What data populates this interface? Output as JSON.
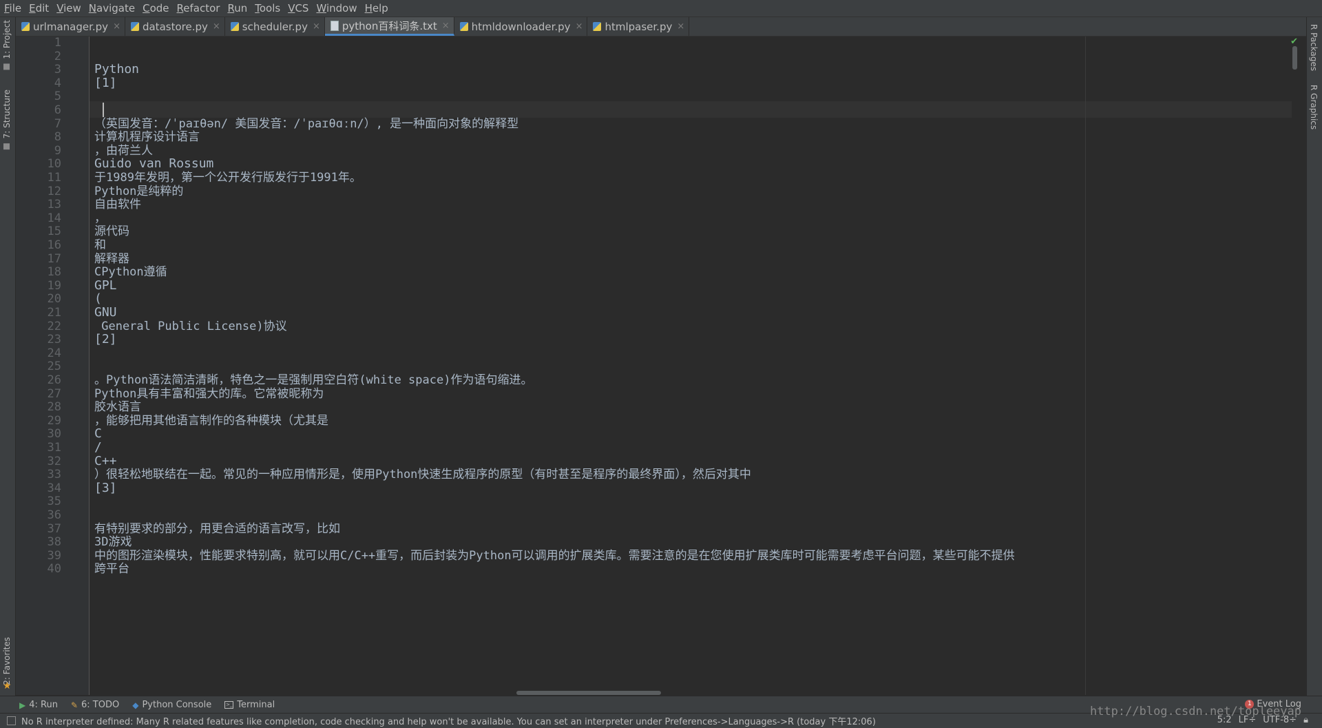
{
  "menu": [
    {
      "mnemonic": "F",
      "rest": "ile"
    },
    {
      "mnemonic": "E",
      "rest": "dit"
    },
    {
      "mnemonic": "V",
      "rest": "iew"
    },
    {
      "mnemonic": "N",
      "rest": "avigate"
    },
    {
      "mnemonic": "C",
      "rest": "ode"
    },
    {
      "mnemonic": "R",
      "rest": "efactor"
    },
    {
      "mnemonic": "R",
      "rest": "un"
    },
    {
      "mnemonic": "T",
      "rest": "ools"
    },
    {
      "mnemonic": "V",
      "rest": "CS"
    },
    {
      "mnemonic": "W",
      "rest": "indow"
    },
    {
      "mnemonic": "H",
      "rest": "elp"
    }
  ],
  "left_tools": {
    "project": "1: Project",
    "structure": "7: Structure",
    "favorites": "2: Favorites"
  },
  "right_tools": {
    "packages": "R Packages",
    "graphics": "R Graphics"
  },
  "tabs": [
    {
      "label": "urlmanager.py",
      "type": "py"
    },
    {
      "label": "datastore.py",
      "type": "py"
    },
    {
      "label": "scheduler.py",
      "type": "py"
    },
    {
      "label": "python百科词条.txt",
      "type": "txt",
      "active": true
    },
    {
      "label": "htmldownloader.py",
      "type": "py"
    },
    {
      "label": "htmlpaser.py",
      "type": "py"
    }
  ],
  "editor": {
    "lines": [
      "",
      "",
      "Python",
      "[1]",
      "",
      "",
      "（英国发音：/ˈpaɪθən/ 美国发音：/ˈpaɪθɑːn/）, 是一种面向对象的解释型",
      "计算机程序设计语言",
      "，由荷兰人",
      "Guido van Rossum",
      "于1989年发明，第一个公开发行版发行于1991年。",
      "Python是纯粹的",
      "自由软件",
      "，",
      "源代码",
      "和",
      "解释器",
      "CPython遵循",
      "GPL",
      "(",
      "GNU",
      " General Public License)协议",
      "[2]",
      "",
      "",
      "。Python语法简洁清晰，特色之一是强制用空白符(white space)作为语句缩进。",
      "Python具有丰富和强大的库。它常被昵称为",
      "胶水语言",
      "，能够把用其他语言制作的各种模块（尤其是",
      "C",
      "/",
      "C++",
      "）很轻松地联结在一起。常见的一种应用情形是，使用Python快速生成程序的原型（有时甚至是程序的最终界面），然后对其中",
      "[3]",
      "",
      "",
      "有特别要求的部分，用更合适的语言改写，比如",
      "3D游戏",
      "中的图形渲染模块，性能要求特别高，就可以用C/C++重写，而后封装为Python可以调用的扩展类库。需要注意的是在您使用扩展类库时可能需要考虑平台问题，某些可能不提供",
      "跨平台"
    ],
    "line_numbers": [
      "1",
      "2",
      "3",
      "4",
      "5",
      "6",
      "7",
      "8",
      "9",
      "10",
      "11",
      "12",
      "13",
      "14",
      "15",
      "16",
      "17",
      "18",
      "19",
      "20",
      "21",
      "22",
      "23",
      "24",
      "25",
      "26",
      "27",
      "28",
      "29",
      "30",
      "31",
      "32",
      "33",
      "34",
      "35",
      "36",
      "37",
      "38",
      "39",
      "40"
    ]
  },
  "bottom_tools": [
    {
      "label": "4: Run",
      "icon": "run-icon"
    },
    {
      "label": "6: TODO",
      "icon": "todo-icon"
    },
    {
      "label": "Python Console",
      "icon": "python-console-icon"
    },
    {
      "label": "Terminal",
      "icon": "terminal-icon"
    }
  ],
  "event_log": {
    "label": "Event Log",
    "count": "1"
  },
  "status": {
    "message": "No R interpreter defined: Many R related features like completion, code checking and help won't be available. You can set an interpreter under Preferences->Languages->R (today 下午12:06)",
    "position": "5:2",
    "line_sep": "LF÷",
    "encoding": "UTF-8÷"
  },
  "watermark": "http://blog.csdn.net/topleeyap",
  "colors": {
    "background": "#2b2b2b",
    "text": "#a9b7c6",
    "accent": "#4a88c7"
  }
}
